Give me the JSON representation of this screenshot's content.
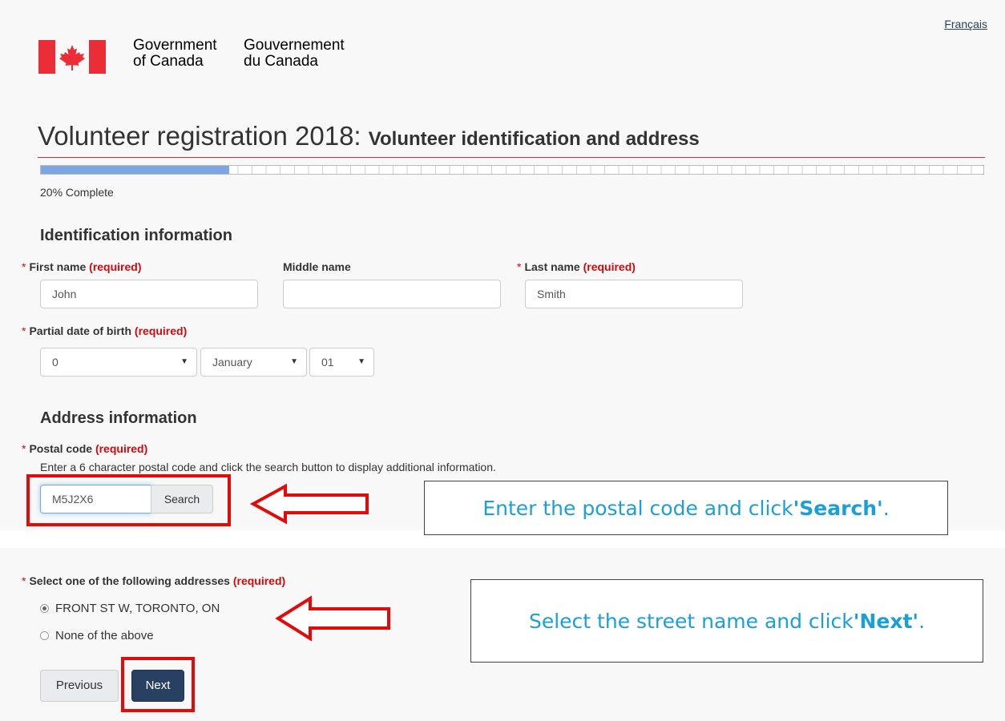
{
  "header": {
    "language_link": "Français",
    "gov_en_line1": "Government",
    "gov_en_line2": "of Canada",
    "gov_fr_line1": "Gouvernement",
    "gov_fr_line2": "du Canada"
  },
  "page": {
    "title_main": "Volunteer registration 2018:",
    "title_sub": "Volunteer identification and address"
  },
  "progress": {
    "percent": 20,
    "label": "20% Complete"
  },
  "identification": {
    "heading": "Identification information",
    "asterisk": "*",
    "required_text": "(required)",
    "first_name_label": "First name",
    "first_name_value": "John",
    "middle_name_label": "Middle name",
    "middle_name_value": "",
    "last_name_label": "Last name",
    "last_name_value": "Smith",
    "dob_label": "Partial date of birth",
    "dob_year": "0",
    "dob_month": "January",
    "dob_day": "01"
  },
  "address": {
    "heading": "Address information",
    "postal_label": "Postal code",
    "postal_help": "Enter a 6 character postal code and click the search button to display additional information.",
    "postal_value": "M5J2X6",
    "search_button": "Search",
    "select_label": "Select one of the following addresses",
    "options": [
      "FRONT ST W, TORONTO, ON",
      "None of the above"
    ],
    "selected_index": 0
  },
  "nav": {
    "previous_button": "Previous",
    "next_button": "Next"
  },
  "callouts": {
    "search_text": "Enter the postal code and click ",
    "search_bold": "'Search'",
    "search_end": ".",
    "next_text": "Select the street name and click ",
    "next_bold": "'Next'",
    "next_end": "."
  },
  "colors": {
    "progress_fill": "#7ba5e5",
    "required_red": "#d3080c",
    "primary_button": "#284162",
    "highlight_red": "#e30a0a",
    "callout_text": "#1a9fd9"
  },
  "icons": {
    "flag": "canada-flag-icon",
    "caret": "caret-down-icon",
    "arrow": "left-arrow-icon"
  }
}
